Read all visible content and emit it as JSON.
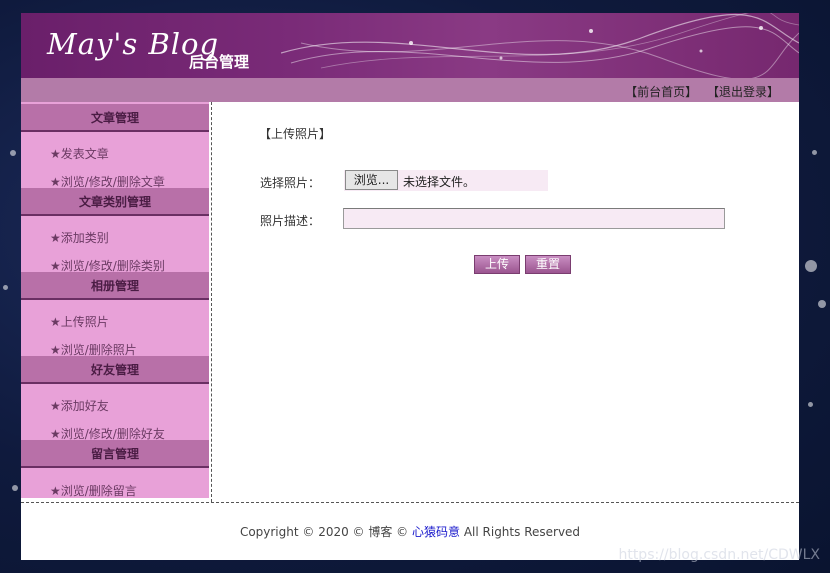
{
  "header": {
    "logo_text": "May's Blog",
    "subtitle": "后台管理"
  },
  "top_links": {
    "home": "【前台首页】",
    "logout": "【退出登录】"
  },
  "sidebar": {
    "sections": [
      {
        "title": "文章管理",
        "items": [
          "★发表文章",
          "★浏览/修改/删除文章"
        ]
      },
      {
        "title": "文章类别管理",
        "items": [
          "★添加类别",
          "★浏览/修改/删除类别"
        ]
      },
      {
        "title": "相册管理",
        "items": [
          "★上传照片",
          "★浏览/删除照片"
        ]
      },
      {
        "title": "好友管理",
        "items": [
          "★添加好友",
          "★浏览/修改/删除好友"
        ]
      },
      {
        "title": "留言管理",
        "items": [
          "★浏览/删除留言"
        ]
      }
    ]
  },
  "main": {
    "section_title": "【上传照片】",
    "file_label": "选择照片：",
    "file_button": "浏览...",
    "file_status": "未选择文件。",
    "desc_label": "照片描述：",
    "desc_value": "",
    "submit_label": "上传",
    "reset_label": "重置"
  },
  "footer": {
    "prefix": "Copyright © 2020 © 博客 © ",
    "link": "心猿码意",
    "suffix": " All Rights Reserved"
  },
  "watermark": "https://blog.csdn.net/CDWLX"
}
